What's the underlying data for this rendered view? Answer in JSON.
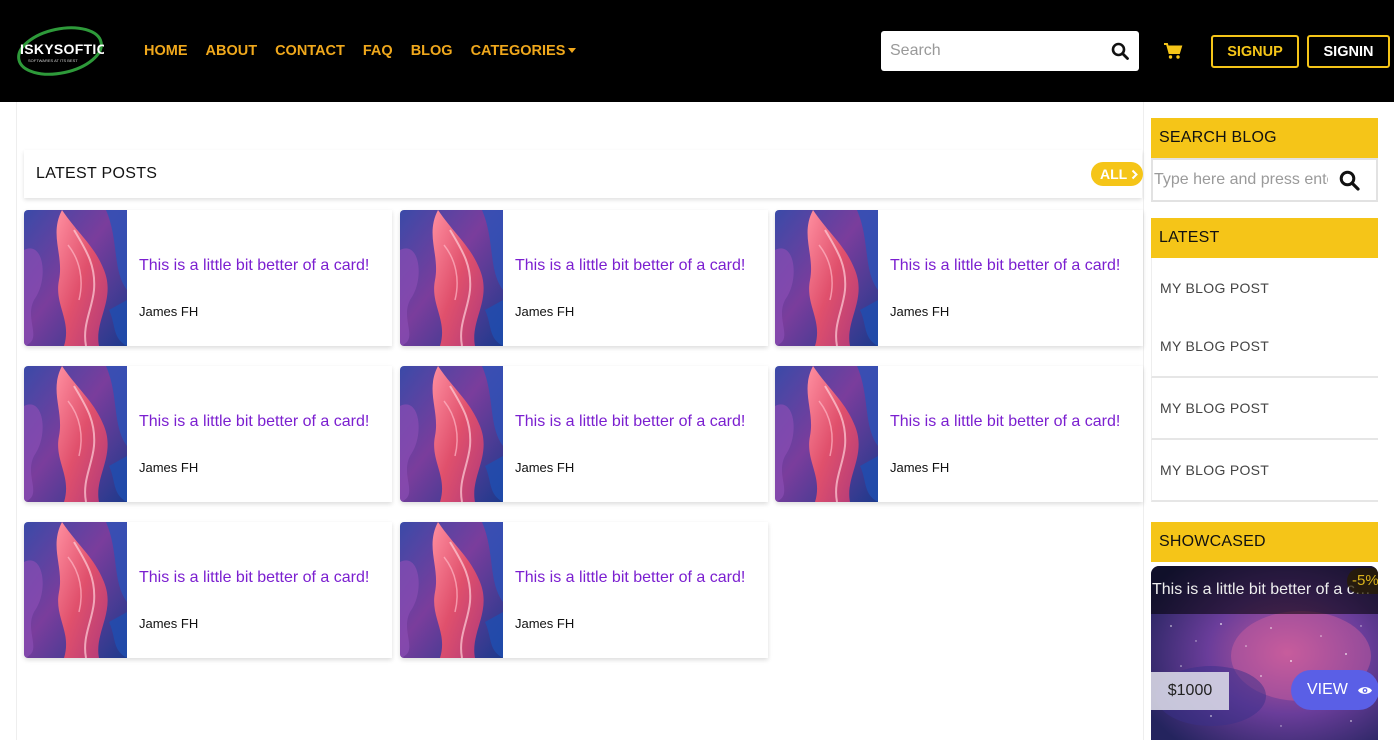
{
  "header": {
    "logo_text": "ISKYSOFTIC",
    "logo_tagline": "SOFTWARES AT ITS BEST",
    "nav": [
      {
        "label": "HOME"
      },
      {
        "label": "ABOUT"
      },
      {
        "label": "CONTACT"
      },
      {
        "label": "FAQ"
      },
      {
        "label": "BLOG"
      },
      {
        "label": "CATEGORIES"
      }
    ],
    "search_placeholder": "Search",
    "signup_label": "SIGNUP",
    "signin_label": "SIGNIN"
  },
  "posts": {
    "title": "LATEST POSTS",
    "all_label": "ALL",
    "cards": [
      {
        "title": "This is a little bit better of a card!",
        "author": "James FH"
      },
      {
        "title": "This is a little bit better of a card!",
        "author": "James FH"
      },
      {
        "title": "This is a little bit better of a card!",
        "author": "James FH"
      },
      {
        "title": "This is a little bit better of a card!",
        "author": "James FH"
      },
      {
        "title": "This is a little bit better of a card!",
        "author": "James FH"
      },
      {
        "title": "This is a little bit better of a card!",
        "author": "James FH"
      },
      {
        "title": "This is a little bit better of a card!",
        "author": "James FH"
      },
      {
        "title": "This is a little bit better of a card!",
        "author": "James FH"
      }
    ]
  },
  "sidebar": {
    "search_heading": "SEARCH BLOG",
    "search_placeholder": "Type here and press enter",
    "latest_heading": "LATEST",
    "latest_items": [
      {
        "label": "MY BLOG POST"
      },
      {
        "label": "MY BLOG POST"
      },
      {
        "label": "MY BLOG POST"
      },
      {
        "label": "MY BLOG POST"
      }
    ],
    "showcased_heading": "SHOWCASED",
    "showcase": {
      "title": "This is a little bit better of a card!",
      "discount": "-5%",
      "price": "$1000",
      "view_label": "VIEW"
    }
  },
  "colors": {
    "header_bg": "#000000",
    "nav_text": "#f0a81c",
    "accent_yellow": "#f5c518",
    "card_title": "#7b1fd0",
    "view_button": "#5a5fe6"
  },
  "icons": {
    "search": "search-icon",
    "cart": "cart-icon",
    "caret": "caret-down-icon",
    "chevron": "chevron-right-icon",
    "eye": "eye-icon"
  }
}
